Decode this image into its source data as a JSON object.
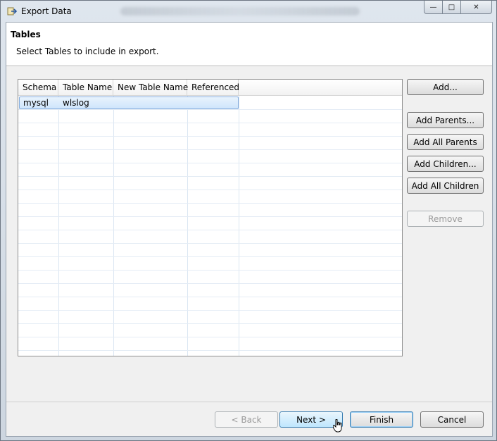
{
  "window": {
    "title": "Export Data",
    "controls": {
      "minimize": "—",
      "maximize": "□",
      "close": "✕"
    }
  },
  "header": {
    "title": "Tables",
    "description": "Select Tables to include in export."
  },
  "table": {
    "columns": [
      "Schema",
      "Table Name",
      "New Table Name",
      "Referenced"
    ],
    "rows": [
      {
        "schema": "mysql",
        "table_name": "wlslog",
        "new_table_name": "",
        "referenced": ""
      }
    ]
  },
  "side_buttons": {
    "add": "Add...",
    "add_parents": "Add Parents...",
    "add_all_parents": "Add All Parents",
    "add_children": "Add Children...",
    "add_all_children": "Add All Children",
    "remove": "Remove"
  },
  "footer_buttons": {
    "back": "< Back",
    "next": "Next >",
    "finish": "Finish",
    "cancel": "Cancel"
  },
  "colors": {
    "selection_bg": "#cfe5fb",
    "selection_border": "#84acdd",
    "hot_button": "#bee6fd"
  }
}
